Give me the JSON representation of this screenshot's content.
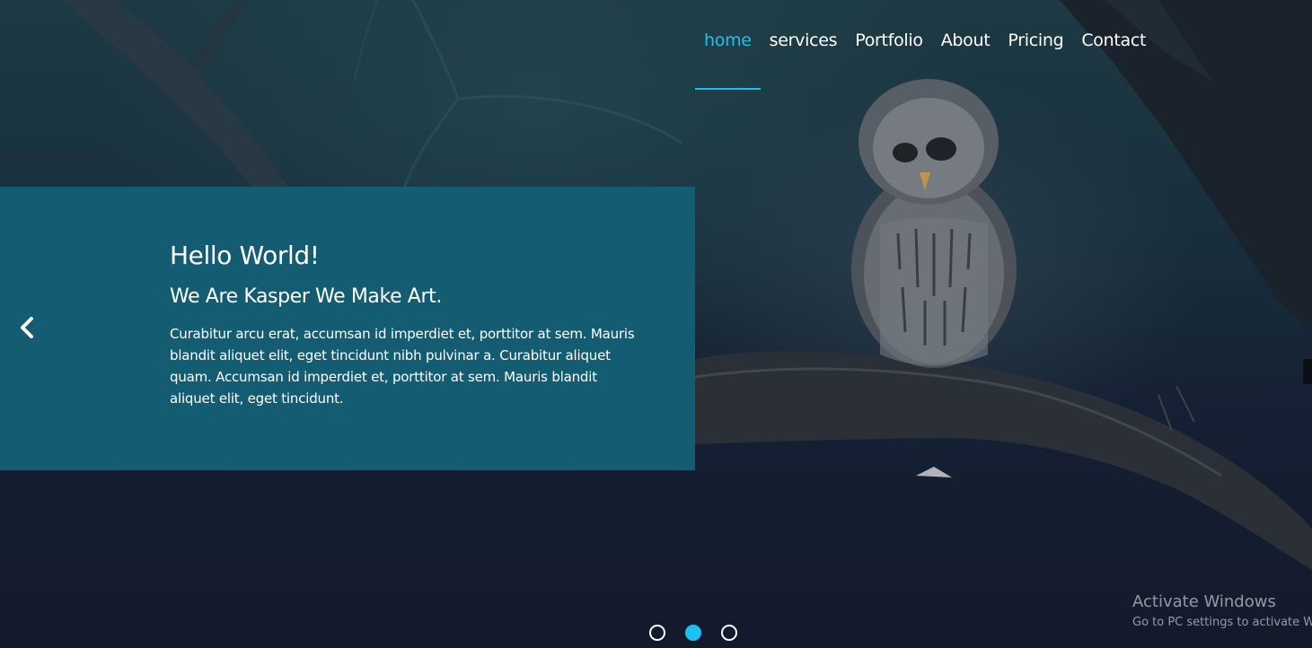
{
  "nav": {
    "items": [
      {
        "label": "home",
        "active": true
      },
      {
        "label": "services"
      },
      {
        "label": "Portfolio"
      },
      {
        "label": "About"
      },
      {
        "label": "Pricing"
      },
      {
        "label": "Contact"
      }
    ]
  },
  "slide": {
    "title": "Hello World!",
    "subtitle": "We Are Kasper We Make Art.",
    "text": "Curabitur arcu erat, accumsan id imperdiet et, porttitor at sem. Mauris blandit aliquet elit, eget tincidunt nibh pulvinar a. Curabitur aliquet quam. Accumsan id imperdiet et, porttitor at sem. Mauris blandit aliquet elit, eget tincidunt.",
    "prev_icon": "chevron-left-icon",
    "next_icon": "chevron-right-icon"
  },
  "dots": {
    "count": 3,
    "active_index": 1
  },
  "watermark": {
    "title": "Activate Windows",
    "subtitle": "Go to PC settings to activate W"
  },
  "colors": {
    "accent": "#19c2f0",
    "panel": "#135c72",
    "text": "#ffffff"
  }
}
